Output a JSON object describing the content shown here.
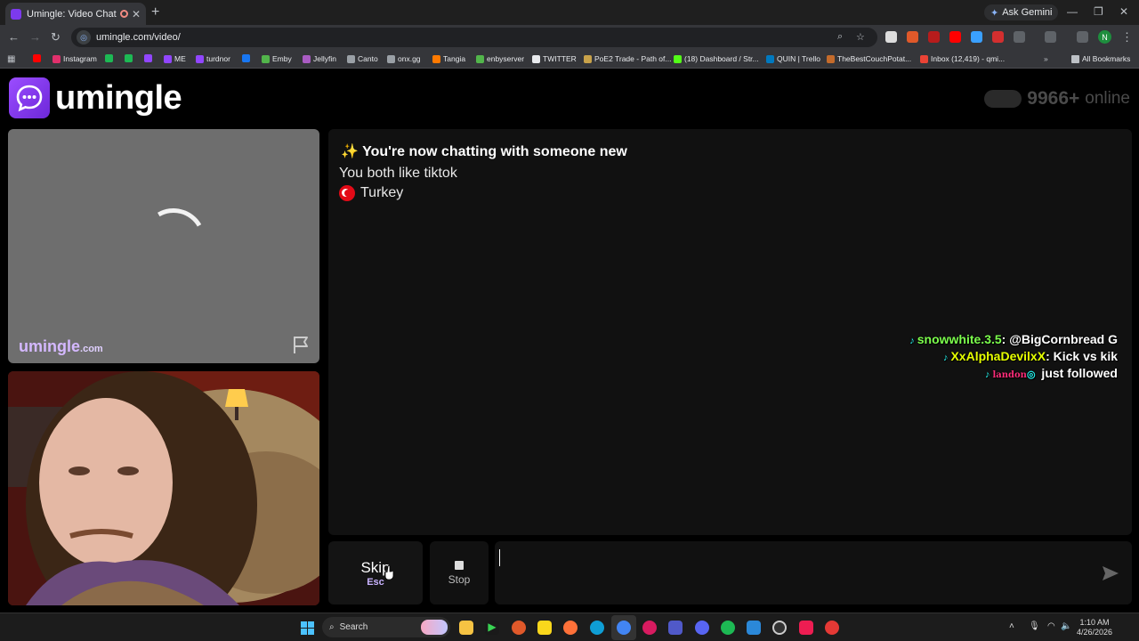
{
  "browser": {
    "tab_title": "Umingle: Video Chat with S",
    "tab_close": "✕",
    "new_tab": "+",
    "ask_gemini": "Ask Gemini",
    "url": "umingle.com/video/",
    "profile_initial": "N",
    "bookmarks": [
      {
        "label": "",
        "color": "#ff0000"
      },
      {
        "label": "Instagram",
        "color": "#e1306c"
      },
      {
        "label": "",
        "color": "#1db954"
      },
      {
        "label": "",
        "color": "#1db954"
      },
      {
        "label": "",
        "color": "#9146ff"
      },
      {
        "label": "ME",
        "color": "#9146ff"
      },
      {
        "label": "turdnor",
        "color": "#9146ff"
      },
      {
        "label": "",
        "color": "#1877f2"
      },
      {
        "label": "Emby",
        "color": "#52b54b"
      },
      {
        "label": "Jellyfin",
        "color": "#aa5cc3"
      },
      {
        "label": "Canto",
        "color": "#9aa0a6"
      },
      {
        "label": "onx.gg",
        "color": "#9aa0a6"
      },
      {
        "label": "Tangia",
        "color": "#ff7a00"
      },
      {
        "label": "enbyserver",
        "color": "#52b54b"
      },
      {
        "label": "TWITTER",
        "color": "#e8eaed"
      },
      {
        "label": "PoE2 Trade - Path of...",
        "color": "#c8a24a"
      },
      {
        "label": "(18) Dashboard / Str...",
        "color": "#53fc18"
      },
      {
        "label": "QUIN | Trello",
        "color": "#0079bf"
      },
      {
        "label": "TheBestCouchPotat...",
        "color": "#c46b2b"
      },
      {
        "label": "Inbox (12,419) - qmi...",
        "color": "#ea4335"
      }
    ],
    "all_bookmarks": "All Bookmarks"
  },
  "site": {
    "logo_text": "umingle",
    "online_count": "9966+",
    "online_label": "online",
    "remote_watermark": "umingle",
    "remote_watermark_suffix": ".com"
  },
  "chat": {
    "new_chat": "✨ You're now chatting with someone new",
    "common_interest": "You both like tiktok",
    "country": "Turkey"
  },
  "overlay": {
    "lines": [
      {
        "user": "snowwhite.3.5",
        "text": ": @BigCornbread G"
      },
      {
        "user": "XxAlphaDevilxX",
        "text": ": Kick vs kik"
      },
      {
        "user": "landon",
        "text": " just followed"
      }
    ]
  },
  "controls": {
    "skip_label": "Skip",
    "skip_key": "Esc",
    "stop_label": "Stop",
    "message_placeholder": ""
  },
  "taskbar": {
    "search_label": "Search",
    "time": "1:10 AM",
    "date": "4/26/2026"
  }
}
